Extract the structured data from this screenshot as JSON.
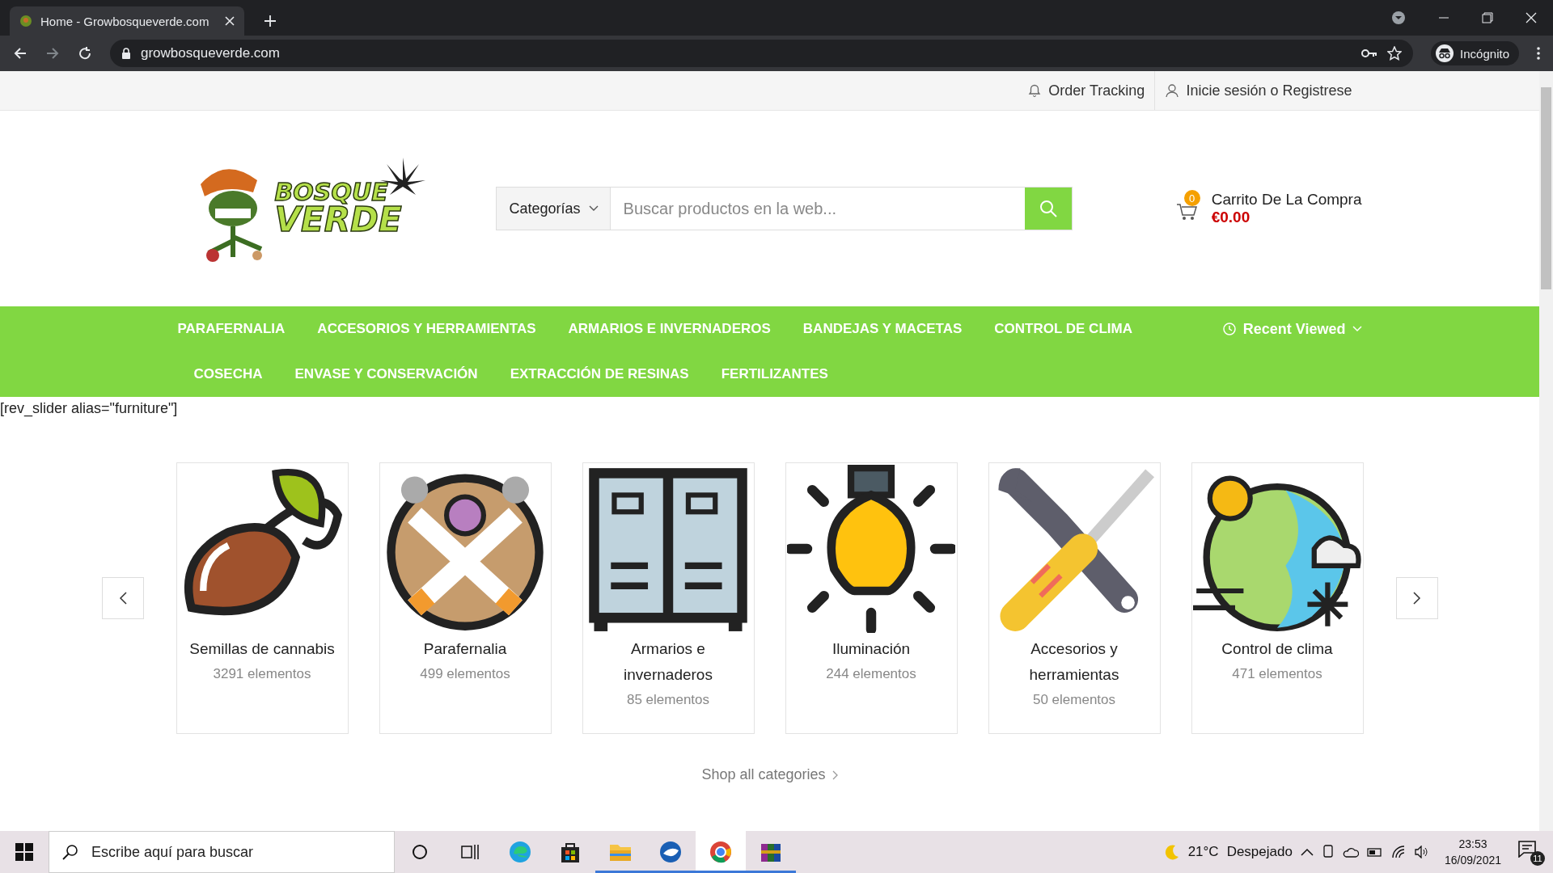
{
  "browser": {
    "tab_title": "Home - Growbosqueverde.com",
    "url": "growbosqueverde.com",
    "profile": "Incógnito"
  },
  "topbar": {
    "links": [
      "Order Tracking",
      "Inicie sesión o Registrese"
    ]
  },
  "header": {
    "logo": [
      "BOSQUE",
      "VERDE"
    ],
    "search": {
      "category": "Categorías",
      "placeholder": "Buscar productos en la web..."
    },
    "cart": {
      "count": "0",
      "label": "Carrito De La Compra",
      "total": "€0.00"
    }
  },
  "nav": {
    "rows": [
      [
        "PARAFERNALIA",
        "ACCESORIOS Y HERRAMIENTAS",
        "ARMARIOS E INVERNADEROS",
        "BANDEJAS Y MACETAS",
        "CONTROL DE CLIMA"
      ],
      [
        "COSECHA",
        "ENVASE Y CONSERVACIÓN",
        "EXTRACCIÓN DE RESINAS",
        "FERTILIZANTES"
      ]
    ],
    "recent": "Recent Viewed"
  },
  "shortcode": "[rev_slider alias=\"furniture\"]",
  "categories": [
    {
      "name": "Semillas de cannabis",
      "count": "3291 elementos"
    },
    {
      "name": "Parafernalia",
      "count": "499 elementos"
    },
    {
      "name": "Armarios e invernaderos",
      "count": "85 elementos"
    },
    {
      "name": "Iluminación",
      "count": "244 elementos"
    },
    {
      "name": "Accesorios y herramientas",
      "count": "50 elementos"
    },
    {
      "name": "Control de clima",
      "count": "471 elementos"
    }
  ],
  "shop_all": "Shop all categories",
  "taskbar": {
    "search_placeholder": "Escribe aquí para buscar",
    "apps": [
      {
        "running": false,
        "selected": false
      },
      {
        "running": false,
        "selected": false
      },
      {
        "running": true,
        "selected": false
      },
      {
        "running": true,
        "selected": false
      },
      {
        "running": true,
        "selected": true
      },
      {
        "running": true,
        "selected": false
      }
    ],
    "temperature": "21°C",
    "weather": "Despejado",
    "time": "23:53",
    "date": "16/09/2021",
    "notifications": "11"
  }
}
